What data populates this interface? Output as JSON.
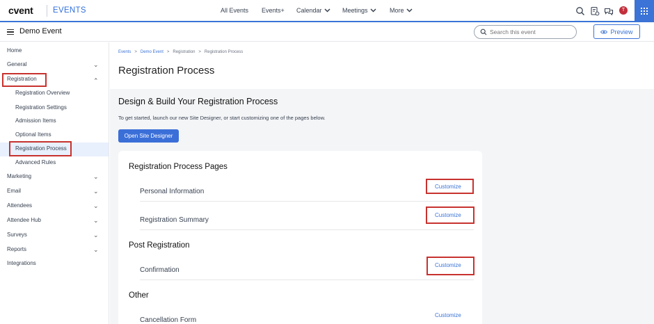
{
  "topbar": {
    "logo": "cvent",
    "product": "EVENTS",
    "nav": [
      {
        "label": "All Events",
        "dropdown": false
      },
      {
        "label": "Events+",
        "dropdown": false
      },
      {
        "label": "Calendar",
        "dropdown": true
      },
      {
        "label": "Meetings",
        "dropdown": true
      },
      {
        "label": "More",
        "dropdown": true
      }
    ],
    "avatar_initial": "T",
    "accent": "#3b73d6",
    "icons": [
      "search-icon",
      "report-icon",
      "chat-icon",
      "avatar",
      "apps-grid-icon"
    ]
  },
  "subbar": {
    "event_name": "Demo Event",
    "search_placeholder": "Search this event",
    "preview_label": "Preview"
  },
  "sidebar": {
    "items": [
      {
        "label": "Home",
        "chevron": ""
      },
      {
        "label": "General",
        "chevron": "down"
      },
      {
        "label": "Registration",
        "chevron": "up"
      },
      {
        "label": "Registration Overview",
        "chevron": ""
      },
      {
        "label": "Registration Settings",
        "chevron": ""
      },
      {
        "label": "Admission Items",
        "chevron": ""
      },
      {
        "label": "Optional Items",
        "chevron": ""
      },
      {
        "label": "Registration Process",
        "chevron": "",
        "active": true
      },
      {
        "label": "Advanced Rules",
        "chevron": ""
      },
      {
        "label": "Marketing",
        "chevron": "down"
      },
      {
        "label": "Email",
        "chevron": "down"
      },
      {
        "label": "Attendees",
        "chevron": "down"
      },
      {
        "label": "Attendee Hub",
        "chevron": "down"
      },
      {
        "label": "Surveys",
        "chevron": "down"
      },
      {
        "label": "Reports",
        "chevron": "down"
      },
      {
        "label": "Integrations",
        "chevron": ""
      }
    ]
  },
  "main": {
    "breadcrumb": [
      "Events",
      "Demo Event",
      "Registration",
      "Registration Process"
    ],
    "title": "Registration Process",
    "design_heading": "Design & Build Your Registration Process",
    "intro": "To get started, launch our new Site Designer, or start customizing one of the pages below.",
    "open_button": "Open Site Designer",
    "sections": [
      {
        "title": "Registration Process Pages",
        "rows": [
          {
            "label": "Personal Information",
            "action": "Customize"
          },
          {
            "label": "Registration Summary",
            "action": "Customize"
          }
        ]
      },
      {
        "title": "Post Registration",
        "rows": [
          {
            "label": "Confirmation",
            "action": "Customize"
          }
        ]
      },
      {
        "title": "Other",
        "rows": [
          {
            "label": "Cancellation Form",
            "action": "Customize"
          }
        ]
      }
    ]
  }
}
